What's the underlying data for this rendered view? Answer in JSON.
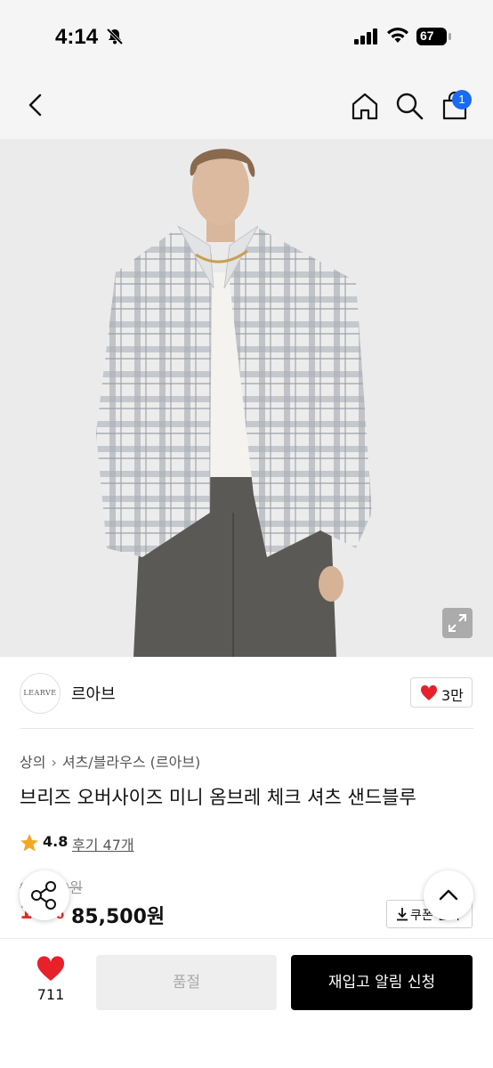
{
  "status_bar": {
    "time": "4:14",
    "battery": "67"
  },
  "nav": {
    "cart_count": "1"
  },
  "brand": {
    "logo_text": "LEARVE",
    "name": "르아브",
    "likes": "3만"
  },
  "breadcrumb": {
    "level1": "상의",
    "level2": "셔츠/블라우스 (르아브)"
  },
  "product": {
    "title": "브리즈 오버사이즈 미니 옴브레 체크 셔츠 샌드블루",
    "rating": "4.8",
    "review_link": "후기 47개",
    "original_price": "95,000원",
    "discount": "10%",
    "price": "85,500원",
    "coupon_label": "쿠폰 받기"
  },
  "bottom_bar": {
    "wish_count": "711",
    "soldout_label": "품절",
    "restock_label": "재입고 알림 신청"
  },
  "colors": {
    "accent_blue": "#1c6af2",
    "discount_red": "#e0302a",
    "heart_red": "#e8202a"
  }
}
